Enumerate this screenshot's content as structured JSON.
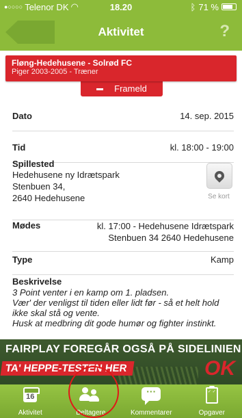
{
  "statusbar": {
    "carrier": "Telenor DK",
    "time": "18.20",
    "battery": "71 %"
  },
  "navbar": {
    "title": "Aktivitet",
    "help": "?"
  },
  "team": {
    "name": "Fløng-Hedehusene - Solrød FC",
    "group": "Piger 2003-2005 - Træner"
  },
  "frameld": {
    "label": "Frameld"
  },
  "details": {
    "dato_label": "Dato",
    "dato_value": "14. sep. 2015",
    "tid_label": "Tid",
    "tid_value": "kl. 18:00 - 19:00",
    "sted_label": "Spillested",
    "sted_line1": "Hedehusene ny Idrætspark",
    "sted_line2": "Stenbuen 34,",
    "sted_line3": "2640 Hedehusene",
    "map_label": "Se kort",
    "moedes_label": "Mødes",
    "moedes_line1": "kl. 17:00 - Hedehusene Idrætspark",
    "moedes_line2": "Stenbuen 34 2640 Hedehusene",
    "type_label": "Type",
    "type_value": "Kamp",
    "beskr_label": "Beskrivelse",
    "beskr_line1": "3 Point venter i en kamp om 1. pladsen.",
    "beskr_line2": "Vær' der venligst til tiden eller lidt før - så et helt hold",
    "beskr_line3": "ikke skal stå og vente.",
    "beskr_line4": "Husk at medbring dit gode humør og fighter instinkt."
  },
  "ad": {
    "line1": "FAIRPLAY FOREGÅR OGSÅ PÅ SIDELINIEN",
    "line2": "TA' HEPPE-TESTEN HER",
    "logo": "OK"
  },
  "tabs": [
    {
      "label": "Aktivitet",
      "icon": "calendar-icon",
      "badge": "16"
    },
    {
      "label": "Deltagere",
      "icon": "participants-icon"
    },
    {
      "label": "Kommentarer",
      "icon": "comment-icon",
      "glyph": "···"
    },
    {
      "label": "Opgaver",
      "icon": "clipboard-icon"
    }
  ],
  "colors": {
    "accent": "#8dbb3a",
    "alert": "#d9262c",
    "highlight": "#e01818"
  }
}
